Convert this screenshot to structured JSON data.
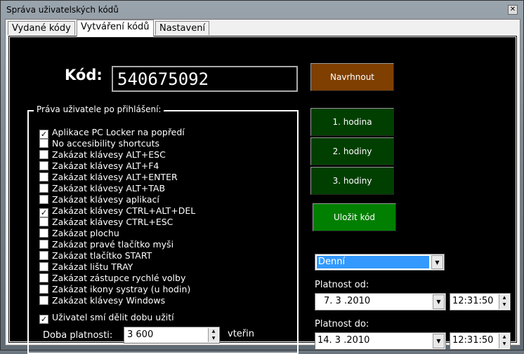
{
  "window": {
    "title": "Správa uživatelských kódů",
    "close_icon": "close-icon"
  },
  "tabs": [
    {
      "label": "Vydané kódy"
    },
    {
      "label": "Vytváření kódů"
    },
    {
      "label": "Nastavení"
    }
  ],
  "code": {
    "label": "Kód:",
    "value": "540675092"
  },
  "rights": {
    "title": "Práva uživatele po přihlášení:",
    "items": [
      {
        "label": "Aplikace PC Locker na popředí",
        "checked": true
      },
      {
        "label": "No accesibility shortcuts",
        "checked": false
      },
      {
        "label": "Zakázat klávesy ALT+ESC",
        "checked": false
      },
      {
        "label": "Zakázat klávesy ALT+F4",
        "checked": false
      },
      {
        "label": "Zakázat klávesy ALT+ENTER",
        "checked": false
      },
      {
        "label": "Zakázat klávesy ALT+TAB",
        "checked": false
      },
      {
        "label": "Zakázat klávesy aplikací",
        "checked": false
      },
      {
        "label": "Zakázat klávesy CTRL+ALT+DEL",
        "checked": true
      },
      {
        "label": "Zakázat klávesy CTRL+ESC",
        "checked": false
      },
      {
        "label": "Zakázat plochu",
        "checked": false
      },
      {
        "label": "Zakázat pravé tlačítko myši",
        "checked": false
      },
      {
        "label": "Zakázat tlačítko START",
        "checked": false
      },
      {
        "label": "Zakázat lištu TRAY",
        "checked": false
      },
      {
        "label": "Zakázat zástupce rychlé volby",
        "checked": false
      },
      {
        "label": "Zakázat ikony systray (u hodin)",
        "checked": false
      },
      {
        "label": "Zakázat klávesy Windows",
        "checked": false
      }
    ],
    "share": {
      "label": "Uživatel smí dělit dobu užití",
      "checked": true
    },
    "duration": {
      "label": "Doba platnosti:",
      "value": "3 600",
      "unit": "vteřin"
    }
  },
  "buttons": {
    "suggest": "Navrhnout",
    "h1": "1. hodina",
    "h2": "2. hodiny",
    "h3": "3. hodiny",
    "save": "Uložit kód"
  },
  "colors": {
    "suggest": "#7f3f00",
    "hour": "#003f00",
    "save": "#007f00",
    "select": "#3399ff"
  },
  "period": {
    "selected": "Denní"
  },
  "valid_from": {
    "label": "Platnost od:",
    "date": "7. 3 .2010",
    "time": "12:31:50"
  },
  "valid_to": {
    "label": "Platnost do:",
    "date": "14. 3 .2010",
    "time": "12:31:50"
  }
}
